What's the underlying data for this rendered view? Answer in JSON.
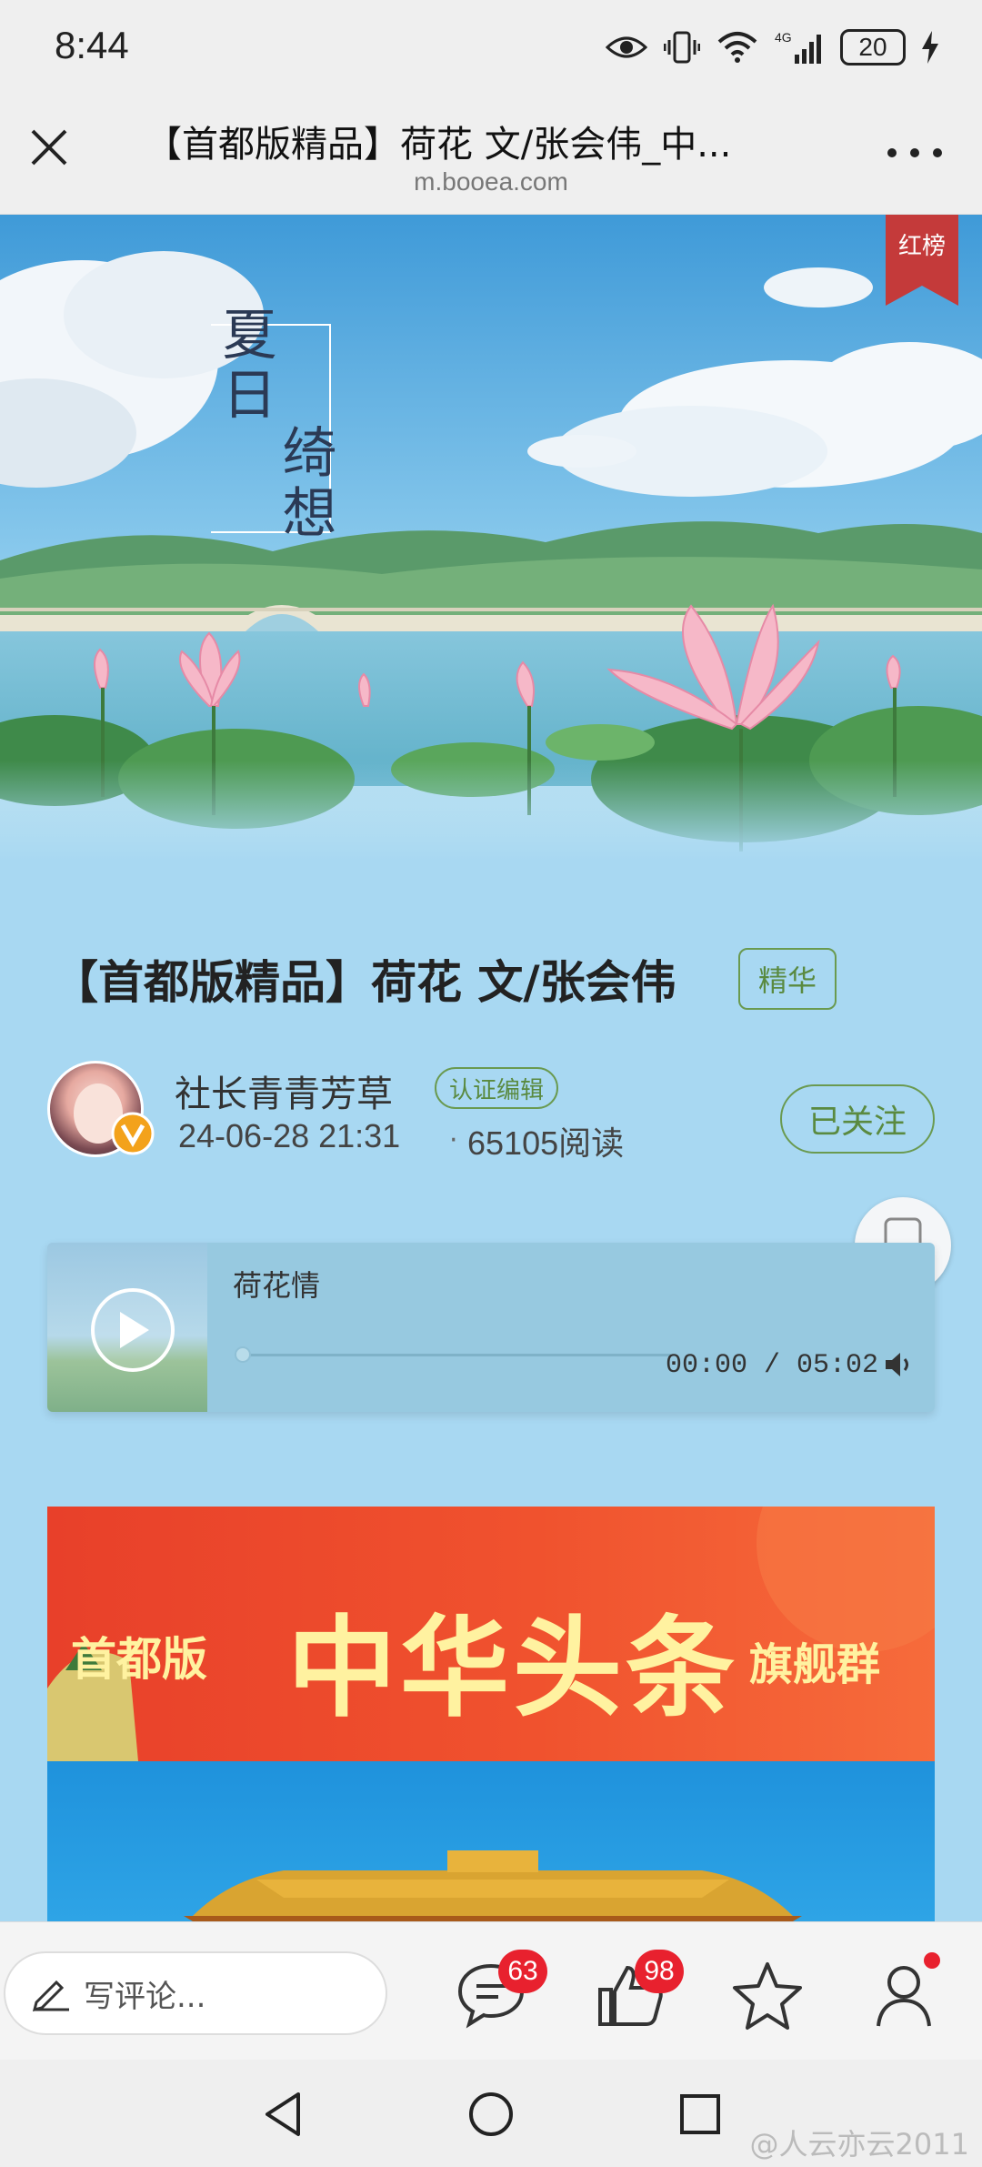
{
  "status_bar": {
    "time": "8:44",
    "battery": "20",
    "network": "4G"
  },
  "browser": {
    "title": "【首都版精品】荷花 文/张会伟_中...",
    "url": "m.booea.com"
  },
  "hero": {
    "title_line1": "夏日",
    "title_line2": "绮想",
    "ribbon_label": "红榜"
  },
  "article": {
    "title": "【首都版精品】荷花 文/张会伟",
    "badge": "精华",
    "author": "社长青青芳草",
    "author_badge": "认证编辑",
    "date": "24-06-28 21:31",
    "reads": "65105阅读",
    "follow_label": "已关注"
  },
  "audio": {
    "title": "荷花情",
    "progress": 0,
    "current_time": "00:00",
    "total_time": "05:02",
    "time_display": "00:00 / 05:02"
  },
  "content_banner": {
    "prefix": "首都版",
    "main": "中华头条",
    "suffix": "旗舰群"
  },
  "bottom_bar": {
    "comment_placeholder": "写评论...",
    "comment_count": "63",
    "like_count": "98"
  },
  "watermark": "@人云亦云2011",
  "colors": {
    "page_bg": "#a8d8f2",
    "accent_green": "#5a8a40",
    "badge_red": "#e8212e",
    "banner_red": "#e8402a"
  }
}
